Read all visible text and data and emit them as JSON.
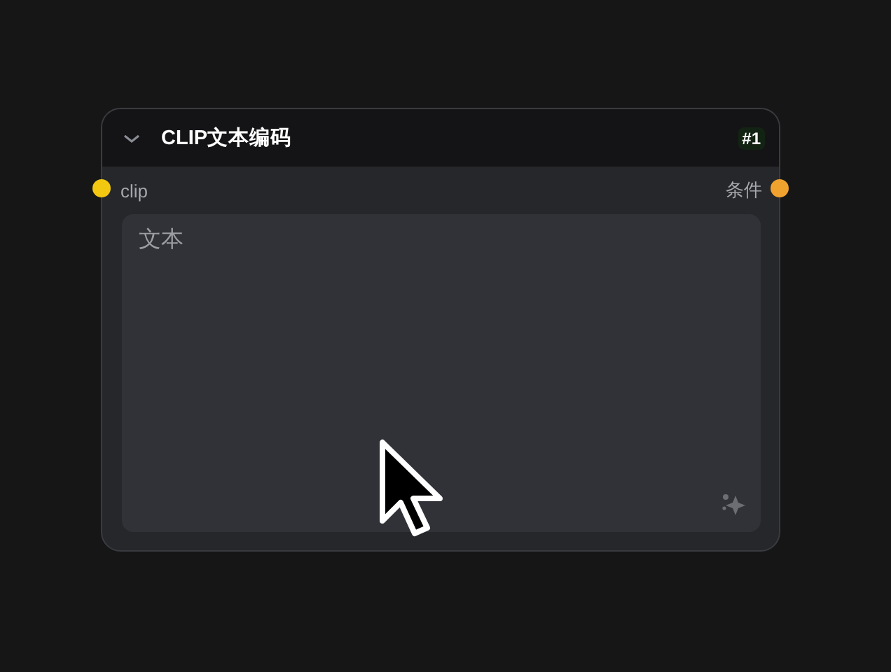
{
  "node": {
    "title": "CLIP文本编码",
    "id_badge": "#1",
    "collapsed": false,
    "inputs": [
      {
        "label": "clip",
        "color": "#f2c811"
      }
    ],
    "outputs": [
      {
        "label": "条件",
        "color": "#f0a22e"
      }
    ],
    "text_field": {
      "placeholder": "文本"
    }
  }
}
